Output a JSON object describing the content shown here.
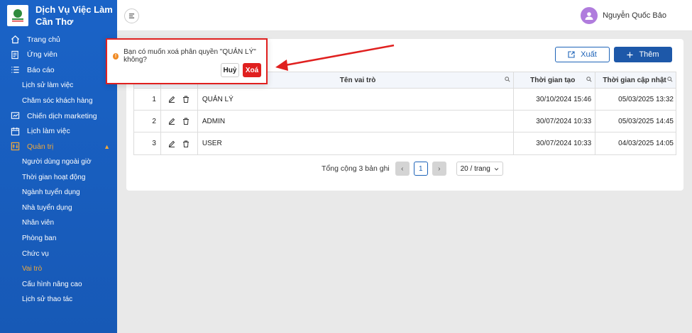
{
  "brand": {
    "title_line1": "Dịch Vụ Việc Làm",
    "title_line2": "Cần Thơ"
  },
  "sidebar": {
    "items": [
      {
        "label": "Trang chủ",
        "icon": "home-icon"
      },
      {
        "label": "Ứng viên",
        "icon": "candidate-icon"
      },
      {
        "label": "Báo cáo",
        "icon": "list-icon"
      },
      {
        "label": "Lịch sử làm việc",
        "sub": true
      },
      {
        "label": "Chăm sóc khách hàng",
        "sub": true
      },
      {
        "label": "Chiến dịch marketing",
        "icon": "campaign-icon"
      },
      {
        "label": "Lịch làm việc",
        "icon": "calendar-icon"
      },
      {
        "label": "Quản trị",
        "icon": "admin-icon",
        "open": true
      },
      {
        "label": "Người dùng ngoài giờ",
        "sub": true
      },
      {
        "label": "Thời gian hoạt động",
        "sub": true
      },
      {
        "label": "Ngành tuyển dụng",
        "sub": true
      },
      {
        "label": "Nhà tuyển dụng",
        "sub": true
      },
      {
        "label": "Nhân viên",
        "sub": true
      },
      {
        "label": "Phòng ban",
        "sub": true
      },
      {
        "label": "Chức vụ",
        "sub": true
      },
      {
        "label": "Vai trò",
        "sub": true,
        "active": true
      },
      {
        "label": "Cấu hình nâng cao",
        "sub": true
      },
      {
        "label": "Lịch sử thao tác",
        "sub": true
      }
    ]
  },
  "header": {
    "user_name": "Nguyễn Quốc Bảo"
  },
  "toolbar": {
    "export_label": "Xuất",
    "add_label": "Thêm"
  },
  "table": {
    "columns": {
      "name": "Tên vai trò",
      "created": "Thời gian tạo",
      "updated": "Thời gian cập nhật"
    },
    "rows": [
      {
        "stt": "1",
        "name": "QUẢN LÝ",
        "created": "30/10/2024 15:46",
        "updated": "05/03/2025 13:32"
      },
      {
        "stt": "2",
        "name": "ADMIN",
        "created": "30/07/2024 10:33",
        "updated": "05/03/2025 14:45"
      },
      {
        "stt": "3",
        "name": "USER",
        "created": "30/07/2024 10:33",
        "updated": "04/03/2025 14:05"
      }
    ]
  },
  "pagination": {
    "total_text": "Tổng cộng 3 bản ghi",
    "current_page": "1",
    "page_size": "20 / trang"
  },
  "popconfirm": {
    "message": "Bạn có muốn xoá phân quyền \"QUẢN LÝ\" không?",
    "cancel_label": "Huỷ",
    "ok_label": "Xoá"
  },
  "colors": {
    "sidebar": "#1a63c7",
    "accent": "#1d58a9",
    "active": "#f2a93b",
    "danger": "#e0201f"
  }
}
